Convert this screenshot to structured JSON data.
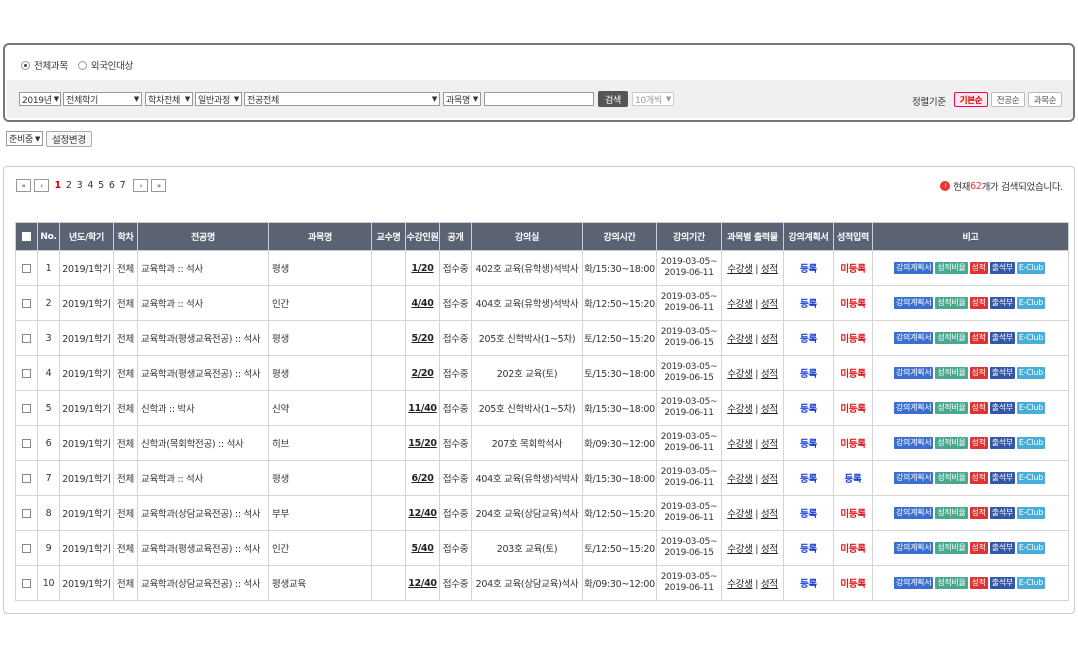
{
  "search": {
    "radios": [
      {
        "label": "전체과목",
        "checked": true
      },
      {
        "label": "외국인대상",
        "checked": false
      }
    ],
    "year": "2019년",
    "term": "전체학기",
    "dept": "학차전체",
    "course_type": "일반과정",
    "major": "전공전체",
    "field": "과목명",
    "query": "",
    "search_label": "검색",
    "page_size": "10개씩",
    "sort_label": "정렬기준",
    "sort_options": [
      "기본순",
      "전공순",
      "과목순"
    ],
    "sort_active": "기본순"
  },
  "toolbar": {
    "status": "준비중",
    "change_label": "설정변경"
  },
  "pager": {
    "first": "«",
    "prev": "‹",
    "pages": [
      "1",
      "2",
      "3",
      "4",
      "5",
      "6",
      "7"
    ],
    "current": "1",
    "next": "›",
    "last": "»"
  },
  "result": {
    "prefix": "현재 ",
    "count": "62",
    "suffix": "개가 검색되었습니다."
  },
  "table": {
    "headers": [
      "No.",
      "년도/학기",
      "학차",
      "전공명",
      "과목명",
      "교수명",
      "수강인원",
      "공개",
      "강의실",
      "강의시간",
      "강의기간",
      "과목별 출력물",
      "강의계획서",
      "성적입력",
      "비고"
    ],
    "rows": [
      {
        "no": "1",
        "term": "2019/1학기",
        "cha": "전체",
        "major": "교육학과 :: 석사",
        "course": "평생",
        "prof": "",
        "enroll": "1/20",
        "open": "접수중",
        "room": "402호 교육(유학생)석박사",
        "time": "화/15:30~18:00",
        "p1": "2019-03-05~",
        "p2": "2019-06-11",
        "o1": "수강생",
        "o2": "성적",
        "plan": "등록",
        "grade": "미등록",
        "gcls": "reg-off"
      },
      {
        "no": "2",
        "term": "2019/1학기",
        "cha": "전체",
        "major": "교육학과 :: 석사",
        "course": "인간",
        "prof": "",
        "enroll": "4/40",
        "open": "접수중",
        "room": "404호 교육(유학생)석박사",
        "time": "화/12:50~15:20",
        "p1": "2019-03-05~",
        "p2": "2019-06-11",
        "o1": "수강생",
        "o2": "성적",
        "plan": "등록",
        "grade": "미등록",
        "gcls": "reg-off"
      },
      {
        "no": "3",
        "term": "2019/1학기",
        "cha": "전체",
        "major": "교육학과(평생교육전공) :: 석사",
        "course": "평생",
        "prof": "",
        "enroll": "5/20",
        "open": "접수중",
        "room": "205호 신학박사(1~5차)",
        "time": "토/12:50~15:20",
        "p1": "2019-03-05~",
        "p2": "2019-06-15",
        "o1": "수강생",
        "o2": "성적",
        "plan": "등록",
        "grade": "미등록",
        "gcls": "reg-off"
      },
      {
        "no": "4",
        "term": "2019/1학기",
        "cha": "전체",
        "major": "교육학과(평생교육전공) :: 석사",
        "course": "평생",
        "prof": "",
        "enroll": "2/20",
        "open": "접수중",
        "room": "202호 교육(토)",
        "time": "토/15:30~18:00",
        "p1": "2019-03-05~",
        "p2": "2019-06-15",
        "o1": "수강생",
        "o2": "성적",
        "plan": "등록",
        "grade": "미등록",
        "gcls": "reg-off"
      },
      {
        "no": "5",
        "term": "2019/1학기",
        "cha": "전체",
        "major": "신학과 :: 박사",
        "course": "신약",
        "prof": "",
        "enroll": "11/40",
        "open": "접수중",
        "room": "205호 신학박사(1~5차)",
        "time": "화/15:30~18:00",
        "p1": "2019-03-05~",
        "p2": "2019-06-11",
        "o1": "수강생",
        "o2": "성적",
        "plan": "등록",
        "grade": "미등록",
        "gcls": "reg-off"
      },
      {
        "no": "6",
        "term": "2019/1학기",
        "cha": "전체",
        "major": "신학과(목회학전공) :: 석사",
        "course": "히브",
        "prof": "",
        "enroll": "15/20",
        "open": "접수중",
        "room": "207호 목회학석사",
        "time": "화/09:30~12:00",
        "p1": "2019-03-05~",
        "p2": "2019-06-11",
        "o1": "수강생",
        "o2": "성적",
        "plan": "등록",
        "grade": "미등록",
        "gcls": "reg-off"
      },
      {
        "no": "7",
        "term": "2019/1학기",
        "cha": "전체",
        "major": "교육학과 :: 석사",
        "course": "평생",
        "prof": "",
        "enroll": "6/20",
        "open": "접수중",
        "room": "404호 교육(유학생)석박사",
        "time": "화/15:30~18:00",
        "p1": "2019-03-05~",
        "p2": "2019-06-11",
        "o1": "수강생",
        "o2": "성적",
        "plan": "등록",
        "grade": "등록",
        "gcls": "reg-on"
      },
      {
        "no": "8",
        "term": "2019/1학기",
        "cha": "전체",
        "major": "교육학과(상담교육전공) :: 석사",
        "course": "부부",
        "prof": "",
        "enroll": "12/40",
        "open": "접수중",
        "room": "204호 교육(상담교육)석사",
        "time": "화/12:50~15:20",
        "p1": "2019-03-05~",
        "p2": "2019-06-11",
        "o1": "수강생",
        "o2": "성적",
        "plan": "등록",
        "grade": "미등록",
        "gcls": "reg-off"
      },
      {
        "no": "9",
        "term": "2019/1학기",
        "cha": "전체",
        "major": "교육학과(평생교육전공) :: 석사",
        "course": "인간",
        "prof": "",
        "enroll": "5/40",
        "open": "접수중",
        "room": "203호 교육(토)",
        "time": "토/12:50~15:20",
        "p1": "2019-03-05~",
        "p2": "2019-06-15",
        "o1": "수강생",
        "o2": "성적",
        "plan": "등록",
        "grade": "미등록",
        "gcls": "reg-off"
      },
      {
        "no": "10",
        "term": "2019/1학기",
        "cha": "전체",
        "major": "교육학과(상담교육전공) :: 석사",
        "course": "평생교육",
        "prof": "",
        "enroll": "12/40",
        "open": "접수중",
        "room": "204호 교육(상담교육)석사",
        "time": "화/09:30~12:00",
        "p1": "2019-03-05~",
        "p2": "2019-06-11",
        "o1": "수강생",
        "o2": "성적",
        "plan": "등록",
        "grade": "미등록",
        "gcls": "reg-off"
      }
    ],
    "action_labels": [
      "강의계획서",
      "성적비율",
      "성적",
      "출석부",
      "E-Club"
    ]
  },
  "colors": {
    "header_bg": "#5b6373",
    "unregistered": "#e1191e",
    "registered": "#1a3fd6",
    "accent": "#e33"
  }
}
